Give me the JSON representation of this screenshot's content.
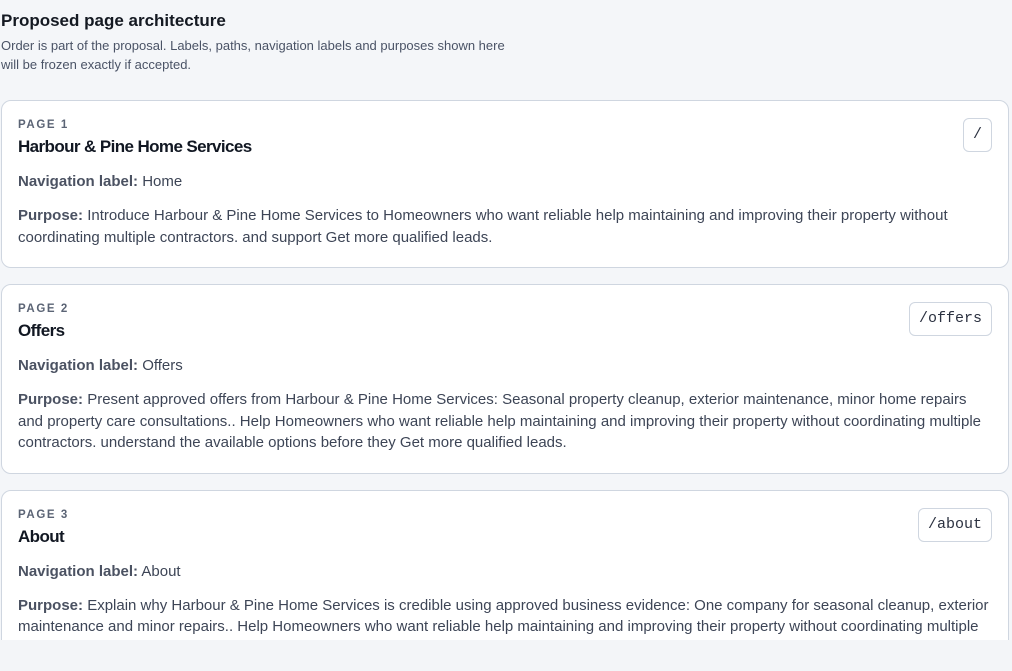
{
  "header": {
    "title": "Proposed page architecture",
    "subtitle": "Order is part of the proposal. Labels, paths, navigation labels and purposes shown here will be frozen exactly if accepted."
  },
  "field_labels": {
    "navigation": "Navigation label:",
    "purpose": "Purpose:"
  },
  "pages": [
    {
      "number": "PAGE 1",
      "label": "Harbour & Pine Home Services",
      "path": "/",
      "nav_label": "Home",
      "purpose": "Introduce Harbour & Pine Home Services to Homeowners who want reliable help maintaining and improving their property without coordinating multiple contractors. and support Get more qualified leads."
    },
    {
      "number": "PAGE 2",
      "label": "Offers",
      "path": "/offers",
      "nav_label": "Offers",
      "purpose": "Present approved offers from Harbour & Pine Home Services: Seasonal property cleanup, exterior maintenance, minor home repairs and property care consultations.. Help Homeowners who want reliable help maintaining and improving their property without coordinating multiple contractors. understand the available options before they Get more qualified leads."
    },
    {
      "number": "PAGE 3",
      "label": "About",
      "path": "/about",
      "nav_label": "About",
      "purpose": "Explain why Harbour & Pine Home Services is credible using approved business evidence: One company for seasonal cleanup, exterior maintenance and minor repairs.. Help Homeowners who want reliable help maintaining and improving their property without coordinating multiple contractors. evaluate the business before they Get more qualified leads."
    }
  ]
}
